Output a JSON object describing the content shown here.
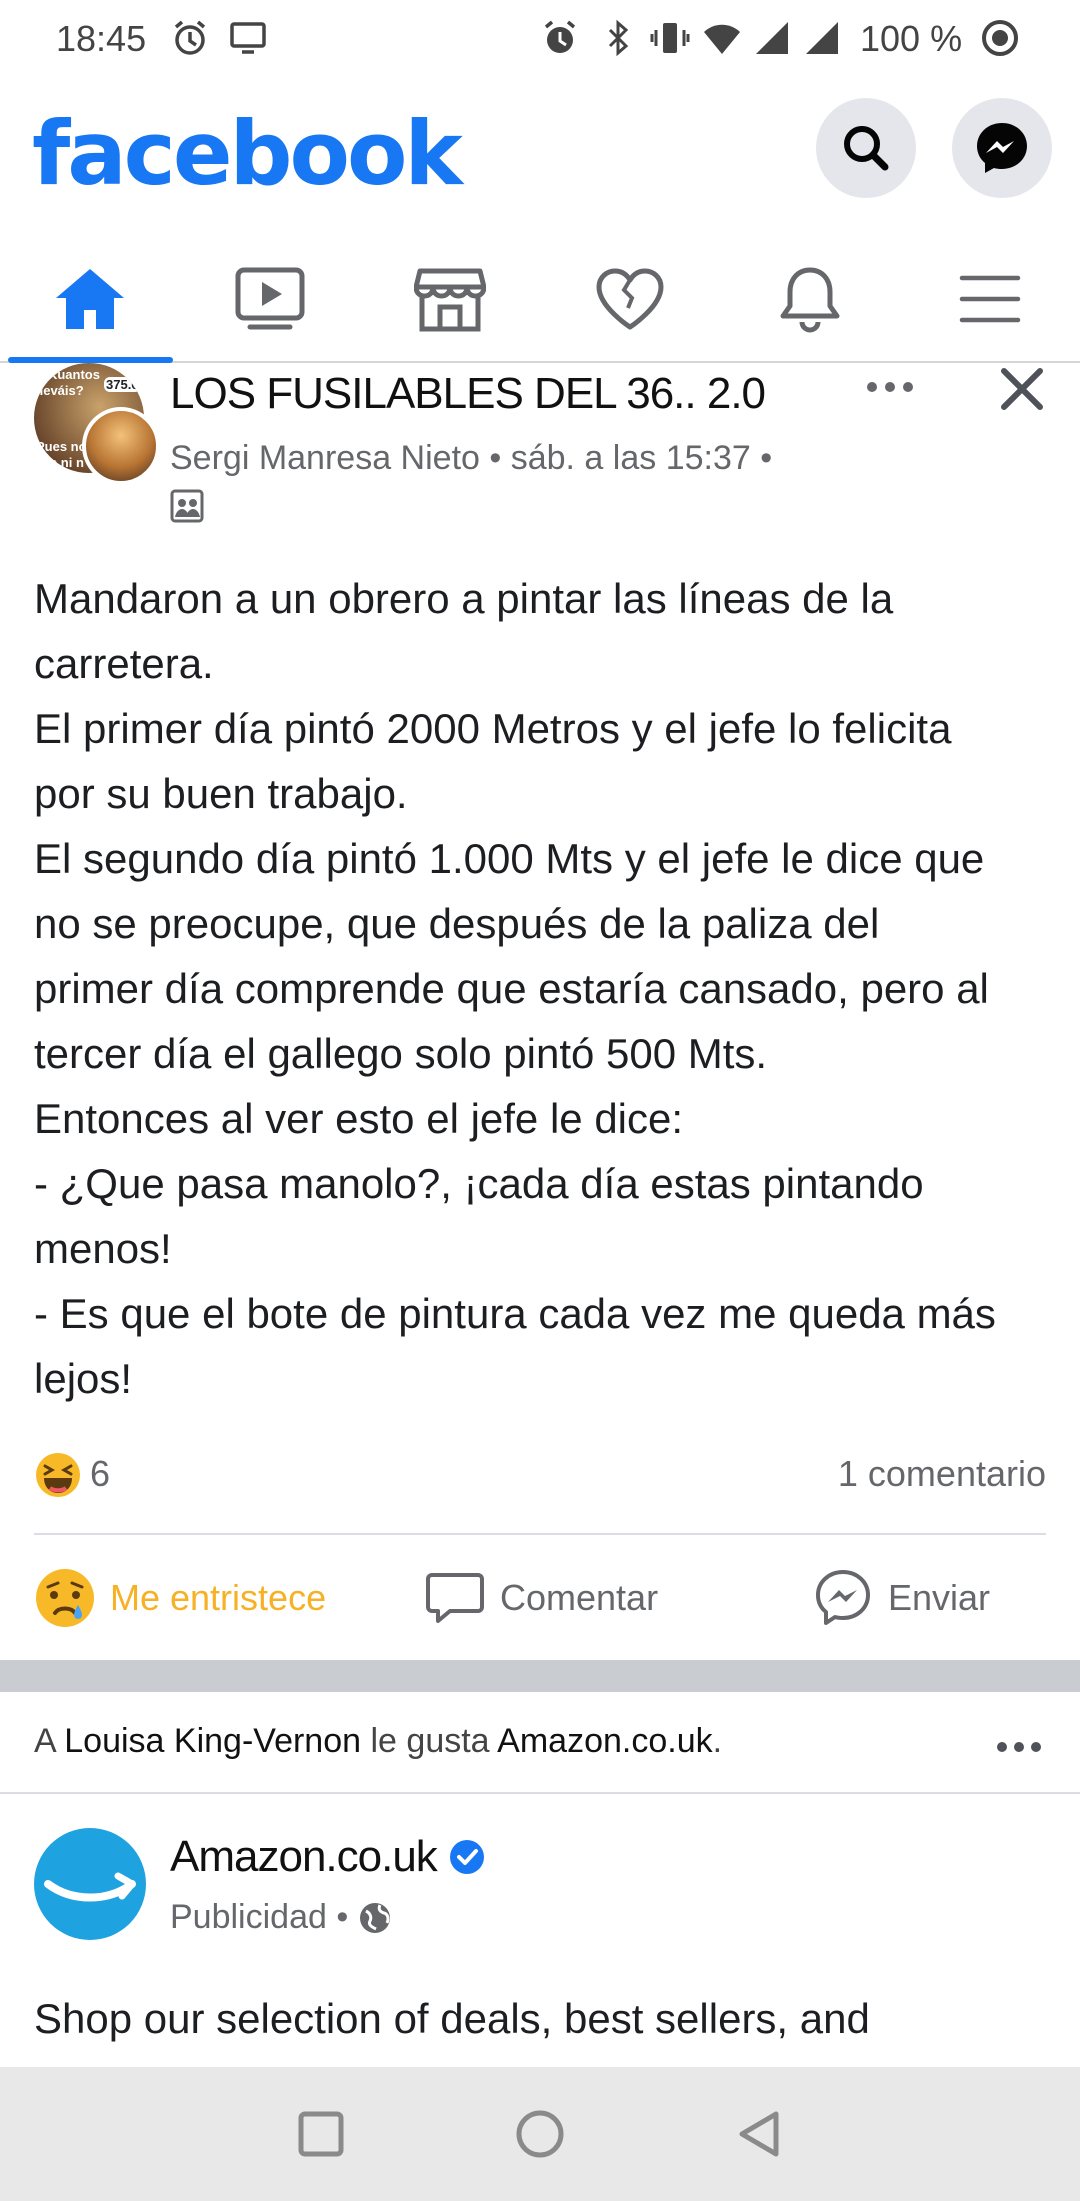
{
  "status_bar": {
    "time": "18:45",
    "battery": "100 %",
    "icons": [
      "alarm-icon",
      "screen-icon",
      "alarm-icon",
      "bluetooth-icon",
      "vibrate-icon",
      "wifi-icon",
      "signal-icon",
      "signal-icon",
      "target-icon"
    ]
  },
  "header": {
    "logo": "facebook",
    "search_icon": "search-icon",
    "messenger_icon": "messenger-icon",
    "brand_color": "#1877f2"
  },
  "tabs": [
    {
      "name": "home",
      "icon": "home-icon",
      "active": true
    },
    {
      "name": "watch",
      "icon": "video-icon",
      "active": false
    },
    {
      "name": "marketplace",
      "icon": "store-icon",
      "active": false
    },
    {
      "name": "dating",
      "icon": "heart-icon",
      "active": false
    },
    {
      "name": "notifications",
      "icon": "bell-icon",
      "active": false
    },
    {
      "name": "menu",
      "icon": "menu-icon",
      "active": false
    }
  ],
  "post": {
    "group": "LOS FUSILABLES DEL 36.. 2.0",
    "author": "Sergi Manresa Nieto",
    "time": "• sáb. a las 15:37 •",
    "avatar_caption": [
      "¿Kuantos",
      "lleváis?",
      "375.0",
      "Pues no",
      "da ni n"
    ],
    "text_lines": [
      "Mandaron a un obrero a pintar las líneas de la",
      "carretera.",
      "El primer día pintó 2000 Metros y el jefe lo felicita",
      "por su buen trabajo.",
      "El segundo día pintó 1.000 Mts y el jefe le dice que",
      "no se preocupe, que después de la paliza del",
      "primer día comprende que estaría cansado, pero al",
      "tercer día el gallego solo pintó 500 Mts.",
      "Entonces al ver esto el jefe le dice:",
      "- ¿Que pasa manolo?, ¡cada día estas pintando",
      "menos!",
      "- Es que el bote de pintura cada vez me queda más",
      "lejos!"
    ],
    "reaction_count": "6",
    "comment_count": "1 comentario",
    "actions": {
      "react": "Me entristece",
      "comment": "Comentar",
      "send": "Enviar"
    },
    "react_color": "#f7b125"
  },
  "ad": {
    "liked_prefix": "A",
    "liked_person": "Louisa King-Vernon",
    "liked_middle": "le gusta",
    "liked_page": "Amazon.co.uk",
    "liked_suffix": ".",
    "advertiser": "Amazon.co.uk",
    "sponsored": "Publicidad •",
    "text": "Shop our selection of deals, best sellers, and"
  },
  "nav": {
    "icons": [
      "recents-icon",
      "home-circle-icon",
      "back-icon"
    ]
  }
}
